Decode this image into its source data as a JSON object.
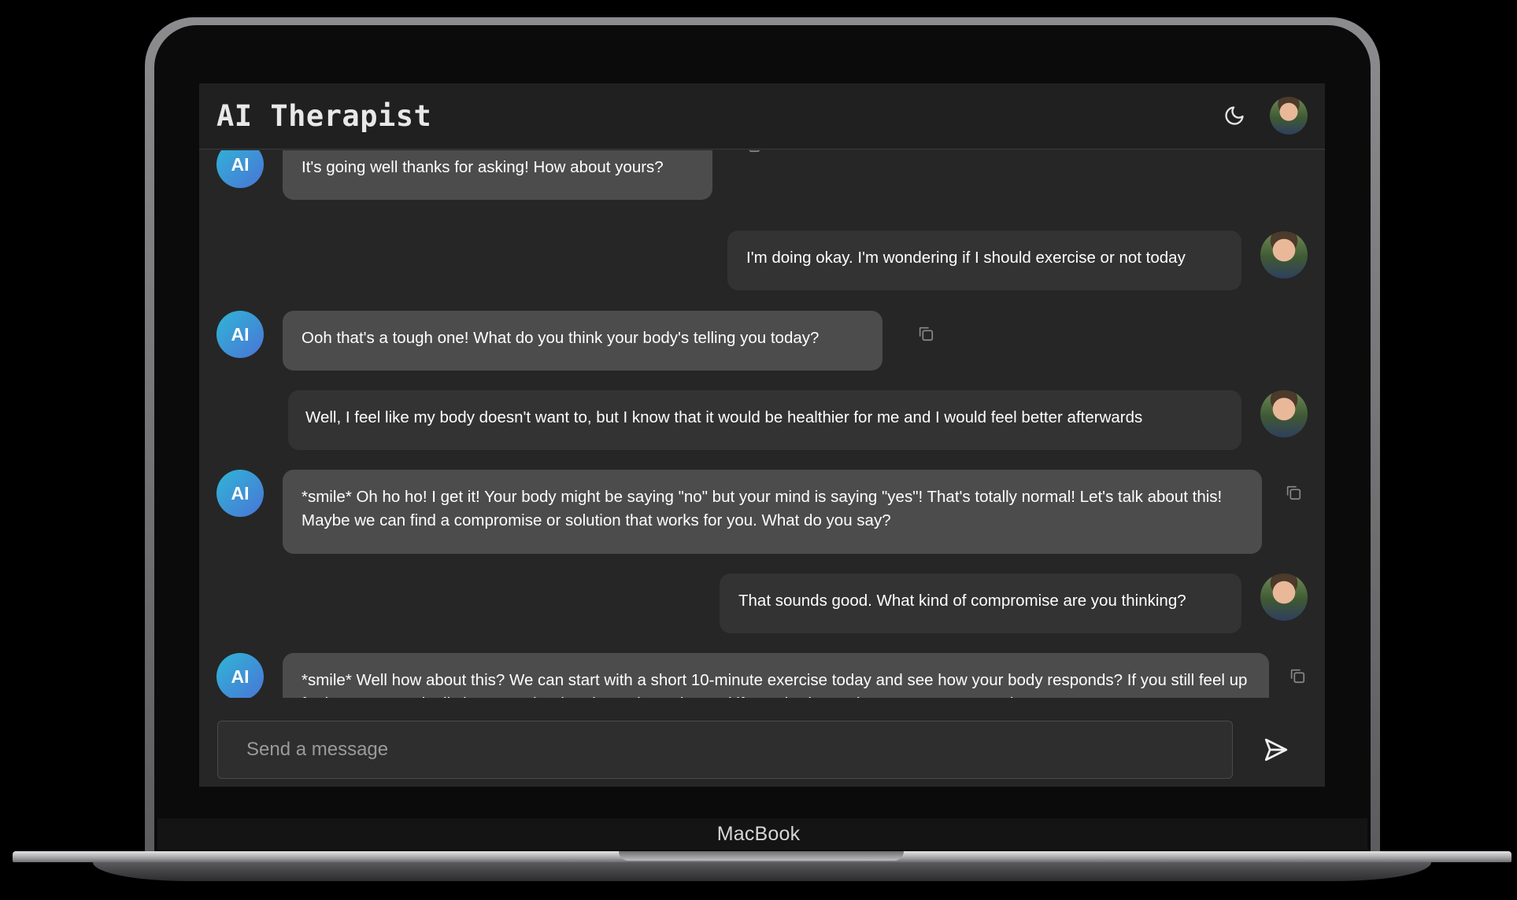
{
  "device": {
    "label": "MacBook"
  },
  "header": {
    "title": "AI Therapist"
  },
  "ai_avatar_label": "AI",
  "messages": [
    {
      "role": "ai",
      "text": "It's going well thanks for asking! How about yours?"
    },
    {
      "role": "user",
      "text": "I'm doing okay. I'm wondering if I should exercise or not today"
    },
    {
      "role": "ai",
      "text": "Ooh that's a tough one! What do you think your body's telling you today?"
    },
    {
      "role": "user",
      "text": "Well, I feel like my body doesn't want to, but I know that it would be healthier for me and I would feel better afterwards"
    },
    {
      "role": "ai",
      "text": "*smile* Oh ho ho! I get it! Your body might be saying \"no\" but your mind is saying \"yes\"! That's totally normal! Let's talk about this! Maybe we can find a compromise or solution that works for you. What do you say?"
    },
    {
      "role": "user",
      "text": "That sounds good. What kind of compromise are you thinking?"
    },
    {
      "role": "ai",
      "text": "*smile* Well how about this? We can start with a short 10-minute exercise today and see how your body responds? If you still feel up for it we can gradually increase the duration or intensity. And if your body needs more rest we can always"
    }
  ],
  "composer": {
    "placeholder": "Send a message"
  },
  "icons": {
    "theme_toggle": "moon-icon",
    "copy": "copy-icon",
    "send": "send-icon"
  },
  "colors": {
    "ai_bubble": "#4c4c4c",
    "user_bubble": "#333333",
    "background": "#262626",
    "ai_avatar_gradient_start": "#2fb6d6",
    "ai_avatar_gradient_end": "#4a74d6"
  }
}
